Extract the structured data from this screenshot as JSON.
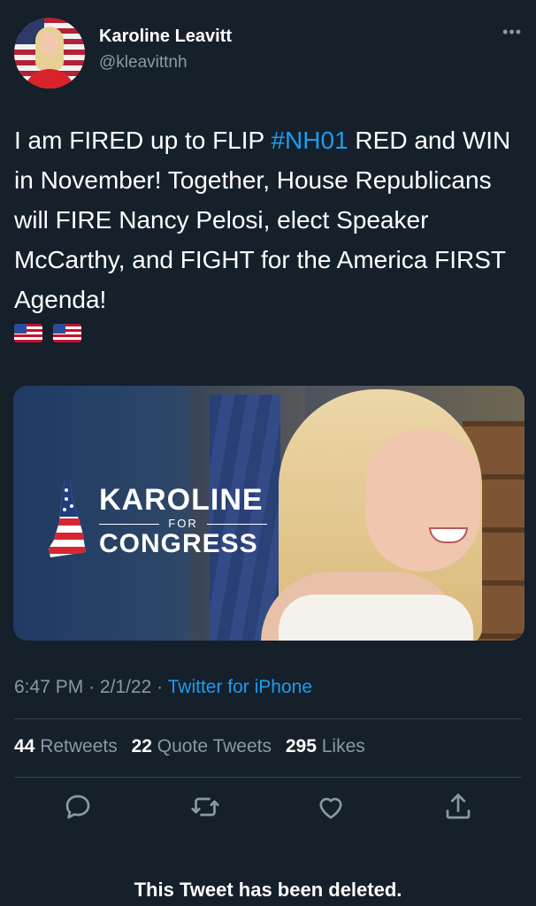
{
  "author": {
    "name": "Karoline Leavitt",
    "handle": "@kleavittnh"
  },
  "menu_icon": "more-horizontal-icon",
  "tweet": {
    "text_before": "I am FIRED up to FLIP ",
    "hashtag": "#NH01",
    "text_after": " RED and WIN in November! Together, House Republicans will FIRE Nancy Pelosi, elect Speaker McCarthy, and FIGHT for the America FIRST Agenda!",
    "emojis": [
      "us-flag-icon",
      "us-flag-icon"
    ]
  },
  "media": {
    "logo_line1": "KAROLINE",
    "logo_for": "FOR",
    "logo_line2": "CONGRESS"
  },
  "meta": {
    "time": "6:47 PM",
    "date": "2/1/22",
    "separator": "·",
    "source": "Twitter for iPhone"
  },
  "stats": {
    "retweets_count": "44",
    "retweets_label": "Retweets",
    "quotes_count": "22",
    "quotes_label": "Quote Tweets",
    "likes_count": "295",
    "likes_label": "Likes"
  },
  "actions": [
    "reply-icon",
    "retweet-icon",
    "like-icon",
    "share-icon"
  ],
  "footer": {
    "deleted_notice": "This Tweet has been deleted."
  },
  "colors": {
    "background": "#15202b",
    "accent": "#1d9bf0",
    "secondary_text": "#8b98a5",
    "divider": "#38444d"
  }
}
